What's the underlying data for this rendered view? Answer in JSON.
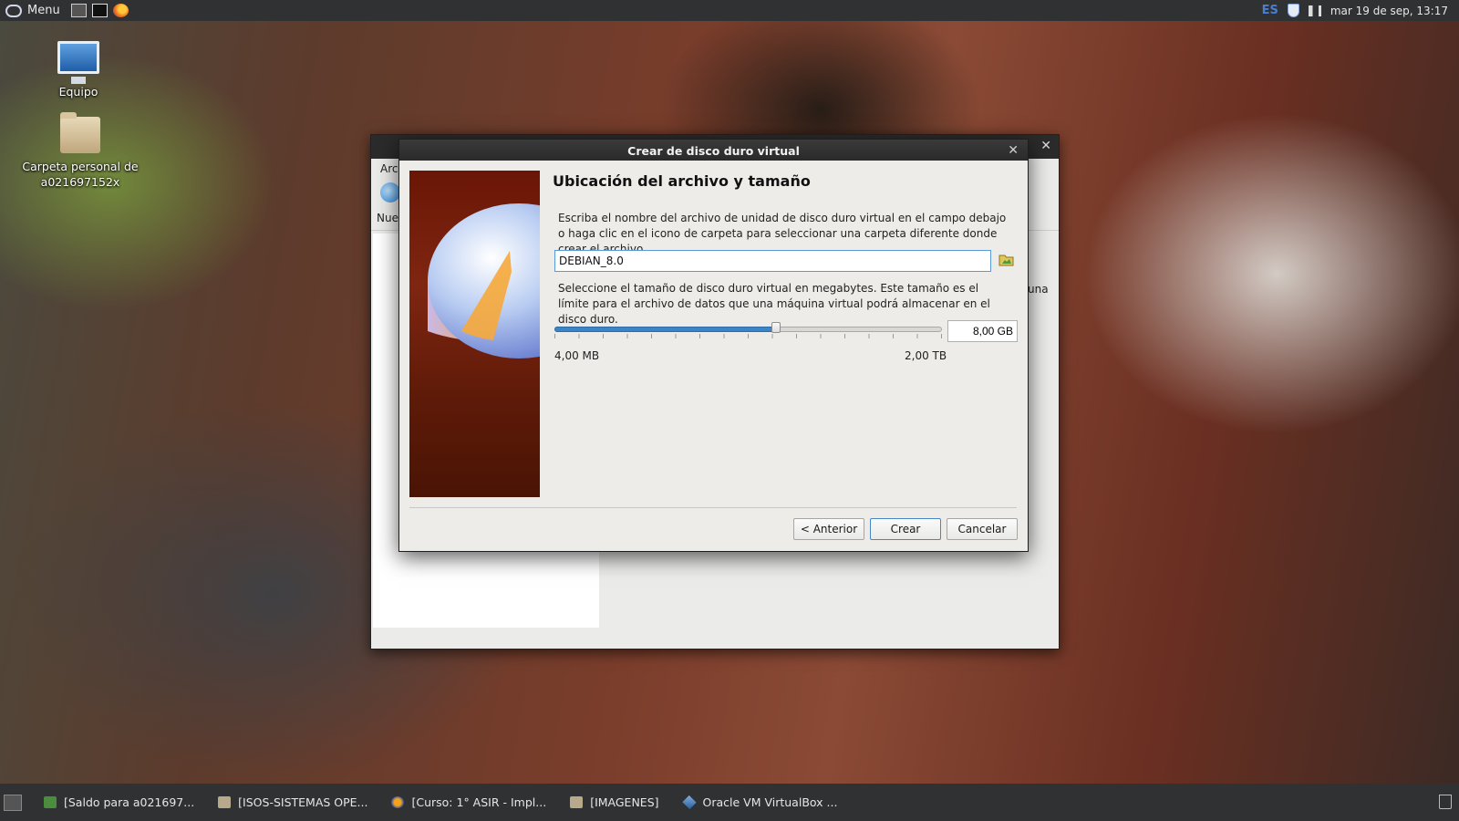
{
  "top_panel": {
    "menu_label": "Menu",
    "launchers": [
      "files-icon",
      "terminal-icon",
      "firefox-icon"
    ],
    "language": "ES",
    "clock": "mar 19 de sep, 13:17"
  },
  "desktop": {
    "icons": [
      {
        "label": "Equipo",
        "icon": "computer-icon"
      },
      {
        "label": "Carpeta personal de a021697152x",
        "icon": "home-folder-icon"
      }
    ]
  },
  "vbox_main": {
    "menu_partial": "Arc",
    "toolbar_new_partial": "Nue",
    "right_partial": "una"
  },
  "dialog": {
    "title": "Crear de disco duro virtual",
    "heading": "Ubicación del archivo y tamaño",
    "location_description": "Escriba el nombre del archivo de unidad de disco duro virtual en el campo debajo o haga clic en el icono de carpeta para seleccionar una carpeta diferente donde crear el archivo.",
    "file_name": "DEBIAN_8.0",
    "size_description": "Seleccione el tamaño de disco duro virtual en megabytes. Este tamaño es el límite para el archivo de datos que una máquina virtual podrá almacenar en el disco duro.",
    "size_value": "8,00 GB",
    "size_slider_fraction": 0.575,
    "range_min": "4,00 MB",
    "range_max": "2,00 TB",
    "buttons": {
      "previous": "< Anterior",
      "create": "Crear",
      "cancel": "Cancelar"
    }
  },
  "taskbar": {
    "tasks": [
      {
        "label": "[Saldo para a021697...",
        "icon": "message-icon"
      },
      {
        "label": "[ISOS-SISTEMAS OPE...",
        "icon": "folder-icon"
      },
      {
        "label": "[Curso: 1° ASIR - Impl...",
        "icon": "firefox-icon"
      },
      {
        "label": "[IMAGENES]",
        "icon": "folder-icon"
      },
      {
        "label": "Oracle VM VirtualBox ...",
        "icon": "virtualbox-icon"
      }
    ]
  },
  "colors": {
    "accent": "#3b85c6",
    "panel": "#2f3133",
    "dialog_bg": "#eeece8"
  }
}
